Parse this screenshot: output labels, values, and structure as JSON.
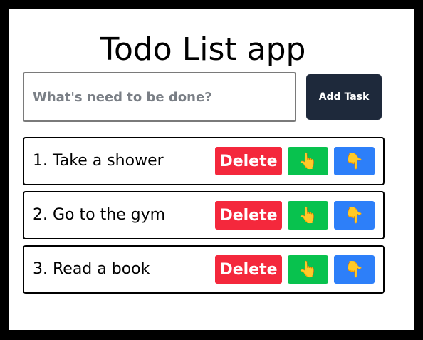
{
  "app": {
    "title": "Todo List app"
  },
  "form": {
    "input_placeholder": "What's need to be done?",
    "input_value": "",
    "add_button_label": "Add Task"
  },
  "todos": [
    {
      "text": "1. Take a shower"
    },
    {
      "text": "2. Go to the gym"
    },
    {
      "text": "3. Read a book"
    }
  ],
  "actions": {
    "delete_label": "Delete",
    "move_up_glyph": "👆",
    "move_down_glyph": "👇"
  },
  "colors": {
    "delete": "#f4283c",
    "move_up": "#08c24e",
    "move_down": "#2d7ff9",
    "add_button": "#1e293b"
  }
}
